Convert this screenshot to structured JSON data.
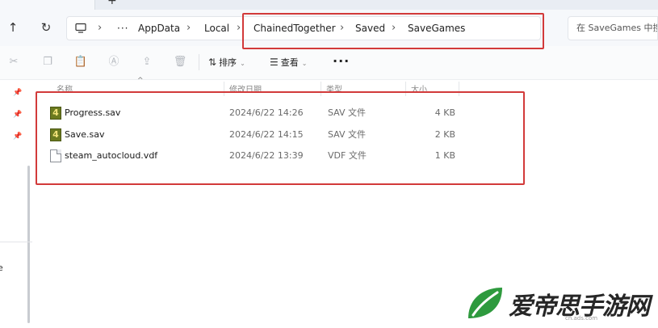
{
  "titlebar": {
    "new_tab_label": "+"
  },
  "nav": {
    "up_icon": "↑",
    "refresh_icon": "↻",
    "breadcrumb": [
      {
        "label": "AppData"
      },
      {
        "label": "Local"
      },
      {
        "label": "ChainedTogether"
      },
      {
        "label": "Saved"
      },
      {
        "label": "SaveGames"
      }
    ],
    "search_placeholder": "在 SaveGames 中搜索"
  },
  "toolbar": {
    "sort_label": "排序",
    "view_label": "查看",
    "more_label": "···"
  },
  "columns": {
    "name": "名称",
    "date": "修改日期",
    "type": "类型",
    "size": "大小"
  },
  "files": [
    {
      "name": "Progress.sav",
      "date": "2024/6/22 14:26",
      "type": "SAV 文件",
      "size": "4 KB",
      "icon": "game-file-icon"
    },
    {
      "name": "Save.sav",
      "date": "2024/6/22 14:15",
      "type": "SAV 文件",
      "size": "2 KB",
      "icon": "game-file-icon"
    },
    {
      "name": "steam_autocloud.vdf",
      "date": "2024/6/22 13:39",
      "type": "VDF 文件",
      "size": "1 KB",
      "icon": "document-icon"
    }
  ],
  "navpane": {
    "partial_label": "e"
  },
  "watermark": {
    "brand": "爱帝思手游网",
    "url": "cn.ads.com"
  },
  "colors": {
    "highlight": "#d23a3a",
    "logo_green": "#2e9a3e"
  }
}
